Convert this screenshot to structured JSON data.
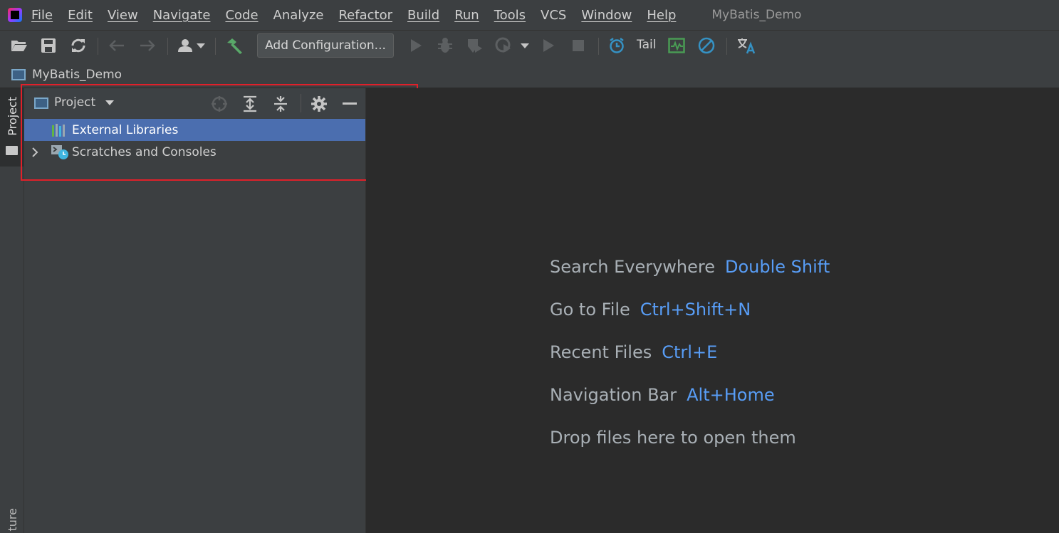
{
  "menu": {
    "items": [
      {
        "label": "File"
      },
      {
        "label": "Edit"
      },
      {
        "label": "View"
      },
      {
        "label": "Navigate"
      },
      {
        "label": "Code"
      },
      {
        "label": "Analyze"
      },
      {
        "label": "Refactor"
      },
      {
        "label": "Build"
      },
      {
        "label": "Run"
      },
      {
        "label": "Tools"
      },
      {
        "label": "VCS"
      },
      {
        "label": "Window"
      },
      {
        "label": "Help"
      }
    ],
    "project_title": "MyBatis_Demo"
  },
  "toolbar": {
    "add_configuration_label": "Add Configuration...",
    "tail_label": "Tail",
    "icons": [
      "open-folder-icon",
      "save-icon",
      "sync-icon",
      "back-arrow-icon",
      "forward-arrow-icon",
      "user-icon",
      "build-hammer-icon",
      "run-icon",
      "debug-icon",
      "coverage-icon",
      "profile-icon",
      "run-dropdown-icon",
      "resume-icon",
      "stop-icon",
      "alarm-clock-icon",
      "monitor-icon",
      "no-entry-icon",
      "translate-icon"
    ]
  },
  "navbar": {
    "project_name": "MyBatis_Demo"
  },
  "left_stripe": {
    "project_tab_label": "Project",
    "bottom_tab_label": "ture"
  },
  "project_panel": {
    "title": "Project",
    "tree": [
      {
        "label": "External Libraries",
        "selected": true
      },
      {
        "label": "Scratches and Consoles",
        "selected": false
      }
    ]
  },
  "editor": {
    "hints": [
      {
        "text": "Search Everywhere",
        "shortcut": "Double Shift"
      },
      {
        "text": "Go to File",
        "shortcut": "Ctrl+Shift+N"
      },
      {
        "text": "Recent Files",
        "shortcut": "Ctrl+E"
      },
      {
        "text": "Navigation Bar",
        "shortcut": "Alt+Home"
      },
      {
        "text": "Drop files here to open them",
        "shortcut": ""
      }
    ]
  },
  "colors": {
    "selection": "#4b6eaf",
    "shortcut": "#589df6",
    "highlight_border": "#e0202a",
    "panel_bg": "#3c3f41",
    "editor_bg": "#2b2b2b"
  }
}
